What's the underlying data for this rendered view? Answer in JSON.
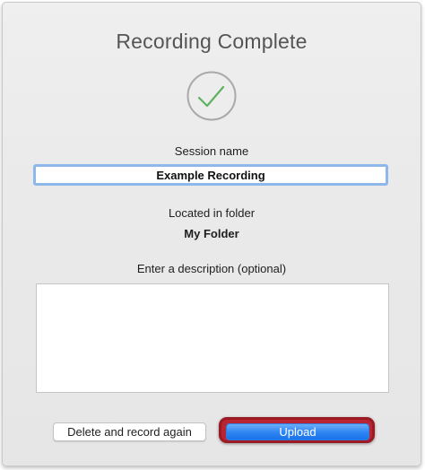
{
  "dialog": {
    "title": "Recording Complete",
    "success_icon": "checkmark-circle-icon",
    "icon_color": "#5fb05f"
  },
  "session": {
    "label": "Session name",
    "value": "Example Recording"
  },
  "folder": {
    "label": "Located in folder",
    "name": "My Folder"
  },
  "description": {
    "label": "Enter a description (optional)",
    "value": ""
  },
  "buttons": {
    "delete_label": "Delete and record again",
    "upload_label": "Upload",
    "upload_color": "#2d84f3",
    "highlight_color": "#b82634"
  }
}
